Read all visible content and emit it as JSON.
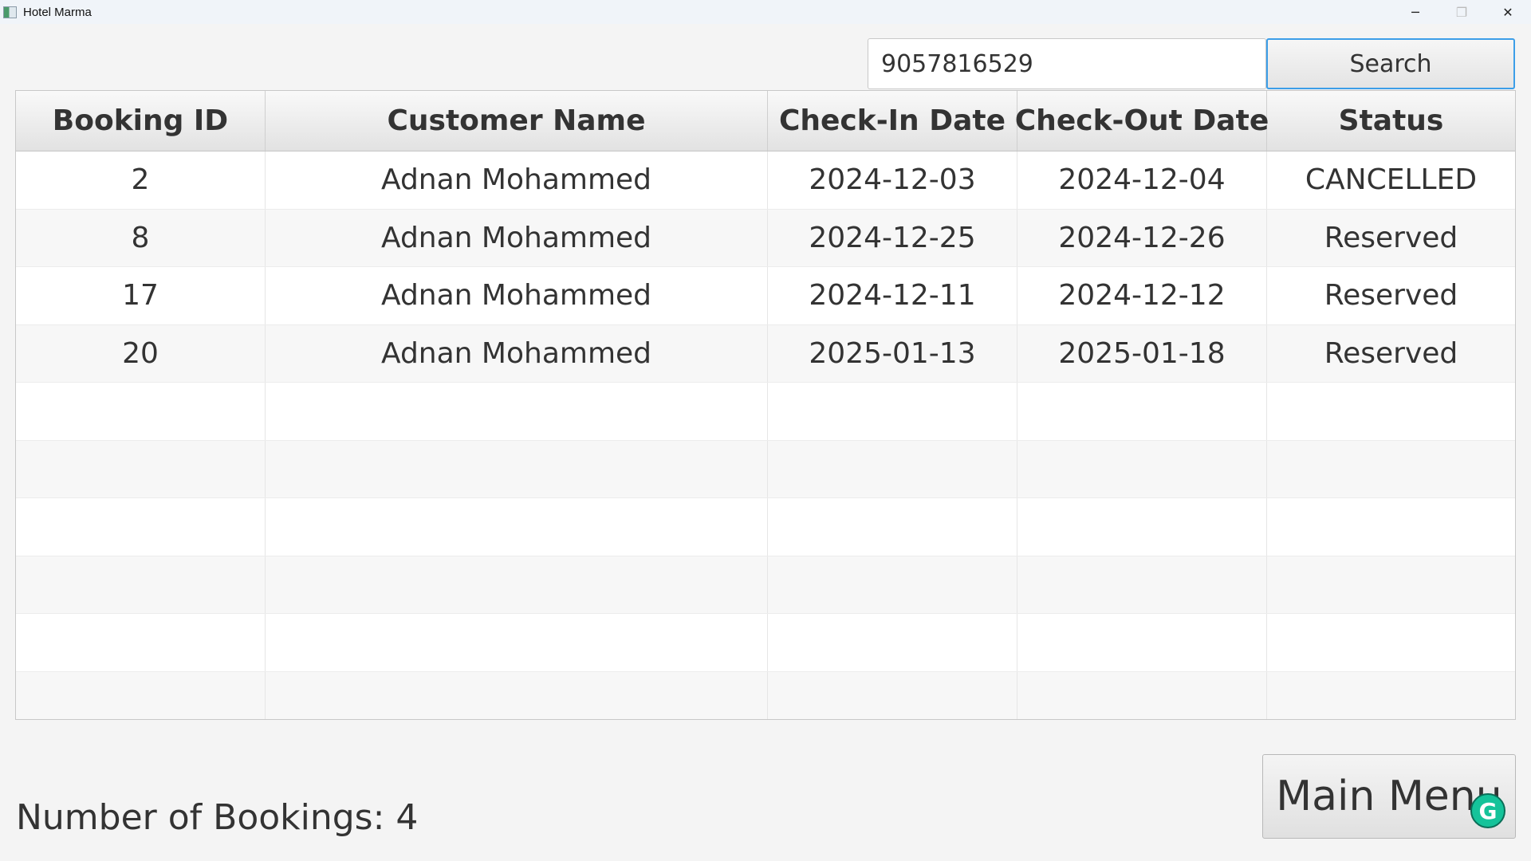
{
  "window": {
    "title": "Hotel Marma",
    "controls": {
      "minimize": "─",
      "restore": "❐",
      "close": "✕"
    }
  },
  "search": {
    "value": "9057816529",
    "button_label": "Search"
  },
  "table": {
    "columns": [
      "Booking ID",
      "Customer Name",
      "Check-In Date",
      "Check-Out Date",
      "Status"
    ],
    "rows": [
      [
        "2",
        "Adnan Mohammed",
        "2024-12-03",
        "2024-12-04",
        "CANCELLED"
      ],
      [
        "8",
        "Adnan Mohammed",
        "2024-12-25",
        "2024-12-26",
        "Reserved"
      ],
      [
        "17",
        "Adnan Mohammed",
        "2024-12-11",
        "2024-12-12",
        "Reserved"
      ],
      [
        "20",
        "Adnan Mohammed",
        "2025-01-13",
        "2025-01-18",
        "Reserved"
      ],
      [
        "",
        "",
        "",
        "",
        ""
      ],
      [
        "",
        "",
        "",
        "",
        ""
      ],
      [
        "",
        "",
        "",
        "",
        ""
      ],
      [
        "",
        "",
        "",
        "",
        ""
      ],
      [
        "",
        "",
        "",
        "",
        ""
      ],
      [
        "",
        "",
        "",
        "",
        ""
      ]
    ]
  },
  "footer": {
    "count_label": "Number of Bookings: 4",
    "main_menu_label": "Main Menu"
  },
  "overlay": {
    "grammarly_glyph": "G"
  },
  "colors": {
    "accent_focus": "#3c9ee8",
    "grammarly": "#15c39a"
  }
}
